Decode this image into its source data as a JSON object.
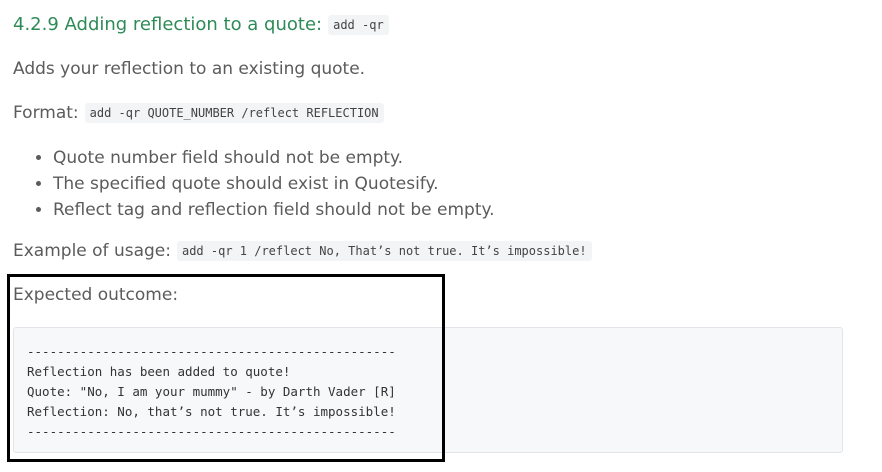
{
  "heading": {
    "text": "4.2.9 Adding reflection to a quote:",
    "code": "add -qr"
  },
  "description": "Adds your reflection to an existing quote.",
  "format": {
    "label": "Format:",
    "code": "add -qr QUOTE_NUMBER /reflect REFLECTION"
  },
  "bullets": [
    "Quote number field should not be empty.",
    "The specified quote should exist in Quotesify.",
    "Reflect tag and reflection field should not be empty."
  ],
  "example": {
    "label": "Example of usage:",
    "code": "add -qr 1 /reflect No, That’s not true. It’s impossible!"
  },
  "outcome": {
    "label": "Expected outcome:",
    "lines": [
      "-------------------------------------------------",
      "Reflection has been added to quote!",
      "Quote: \"No, I am your mummy\" - by Darth Vader [R]",
      "Reflection: No, that’s not true. It’s impossible!",
      "-------------------------------------------------"
    ]
  }
}
